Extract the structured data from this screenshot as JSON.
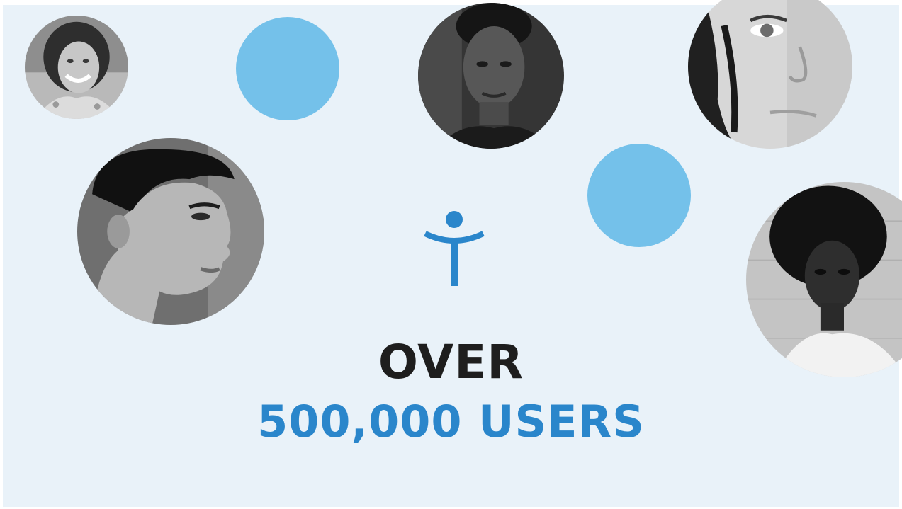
{
  "headline": {
    "line1": "OVER",
    "line2": "500,000 USERS"
  },
  "colors": {
    "background": "#e9f2f9",
    "accent_blue": "#2a86cb",
    "dot_blue": "#74c1ea",
    "dark_text": "#1e1e1e"
  },
  "icons": {
    "logo": "person-figure-logo-icon"
  },
  "photos": [
    {
      "subject": "older-woman-smiling"
    },
    {
      "subject": "man-portrait"
    },
    {
      "subject": "woman-closeup"
    },
    {
      "subject": "young-man-profile"
    },
    {
      "subject": "woman-curly-hair"
    }
  ]
}
